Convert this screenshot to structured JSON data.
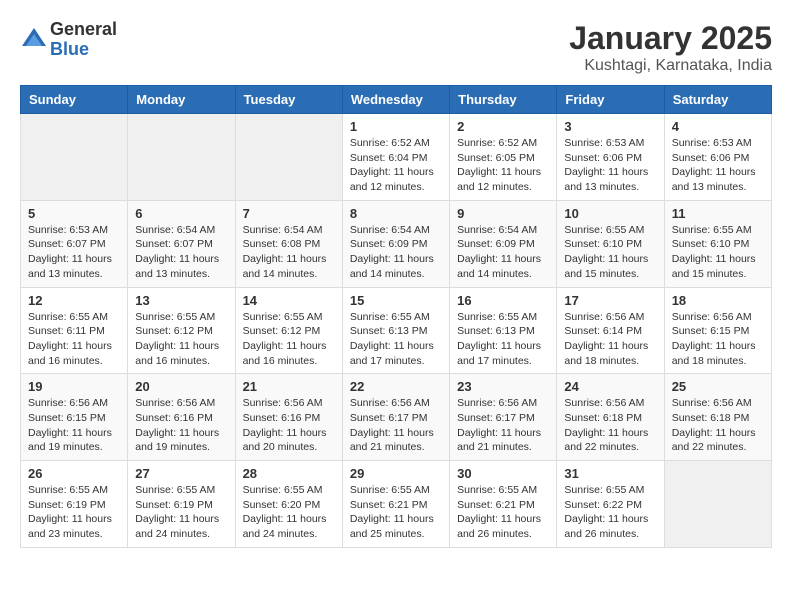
{
  "header": {
    "logo": {
      "general": "General",
      "blue": "Blue"
    },
    "title": "January 2025",
    "location": "Kushtagi, Karnataka, India"
  },
  "calendar": {
    "days_of_week": [
      "Sunday",
      "Monday",
      "Tuesday",
      "Wednesday",
      "Thursday",
      "Friday",
      "Saturday"
    ],
    "weeks": [
      [
        {
          "day": "",
          "info": ""
        },
        {
          "day": "",
          "info": ""
        },
        {
          "day": "",
          "info": ""
        },
        {
          "day": "1",
          "info": "Sunrise: 6:52 AM\nSunset: 6:04 PM\nDaylight: 11 hours\nand 12 minutes."
        },
        {
          "day": "2",
          "info": "Sunrise: 6:52 AM\nSunset: 6:05 PM\nDaylight: 11 hours\nand 12 minutes."
        },
        {
          "day": "3",
          "info": "Sunrise: 6:53 AM\nSunset: 6:06 PM\nDaylight: 11 hours\nand 13 minutes."
        },
        {
          "day": "4",
          "info": "Sunrise: 6:53 AM\nSunset: 6:06 PM\nDaylight: 11 hours\nand 13 minutes."
        }
      ],
      [
        {
          "day": "5",
          "info": "Sunrise: 6:53 AM\nSunset: 6:07 PM\nDaylight: 11 hours\nand 13 minutes."
        },
        {
          "day": "6",
          "info": "Sunrise: 6:54 AM\nSunset: 6:07 PM\nDaylight: 11 hours\nand 13 minutes."
        },
        {
          "day": "7",
          "info": "Sunrise: 6:54 AM\nSunset: 6:08 PM\nDaylight: 11 hours\nand 14 minutes."
        },
        {
          "day": "8",
          "info": "Sunrise: 6:54 AM\nSunset: 6:09 PM\nDaylight: 11 hours\nand 14 minutes."
        },
        {
          "day": "9",
          "info": "Sunrise: 6:54 AM\nSunset: 6:09 PM\nDaylight: 11 hours\nand 14 minutes."
        },
        {
          "day": "10",
          "info": "Sunrise: 6:55 AM\nSunset: 6:10 PM\nDaylight: 11 hours\nand 15 minutes."
        },
        {
          "day": "11",
          "info": "Sunrise: 6:55 AM\nSunset: 6:10 PM\nDaylight: 11 hours\nand 15 minutes."
        }
      ],
      [
        {
          "day": "12",
          "info": "Sunrise: 6:55 AM\nSunset: 6:11 PM\nDaylight: 11 hours\nand 16 minutes."
        },
        {
          "day": "13",
          "info": "Sunrise: 6:55 AM\nSunset: 6:12 PM\nDaylight: 11 hours\nand 16 minutes."
        },
        {
          "day": "14",
          "info": "Sunrise: 6:55 AM\nSunset: 6:12 PM\nDaylight: 11 hours\nand 16 minutes."
        },
        {
          "day": "15",
          "info": "Sunrise: 6:55 AM\nSunset: 6:13 PM\nDaylight: 11 hours\nand 17 minutes."
        },
        {
          "day": "16",
          "info": "Sunrise: 6:55 AM\nSunset: 6:13 PM\nDaylight: 11 hours\nand 17 minutes."
        },
        {
          "day": "17",
          "info": "Sunrise: 6:56 AM\nSunset: 6:14 PM\nDaylight: 11 hours\nand 18 minutes."
        },
        {
          "day": "18",
          "info": "Sunrise: 6:56 AM\nSunset: 6:15 PM\nDaylight: 11 hours\nand 18 minutes."
        }
      ],
      [
        {
          "day": "19",
          "info": "Sunrise: 6:56 AM\nSunset: 6:15 PM\nDaylight: 11 hours\nand 19 minutes."
        },
        {
          "day": "20",
          "info": "Sunrise: 6:56 AM\nSunset: 6:16 PM\nDaylight: 11 hours\nand 19 minutes."
        },
        {
          "day": "21",
          "info": "Sunrise: 6:56 AM\nSunset: 6:16 PM\nDaylight: 11 hours\nand 20 minutes."
        },
        {
          "day": "22",
          "info": "Sunrise: 6:56 AM\nSunset: 6:17 PM\nDaylight: 11 hours\nand 21 minutes."
        },
        {
          "day": "23",
          "info": "Sunrise: 6:56 AM\nSunset: 6:17 PM\nDaylight: 11 hours\nand 21 minutes."
        },
        {
          "day": "24",
          "info": "Sunrise: 6:56 AM\nSunset: 6:18 PM\nDaylight: 11 hours\nand 22 minutes."
        },
        {
          "day": "25",
          "info": "Sunrise: 6:56 AM\nSunset: 6:18 PM\nDaylight: 11 hours\nand 22 minutes."
        }
      ],
      [
        {
          "day": "26",
          "info": "Sunrise: 6:55 AM\nSunset: 6:19 PM\nDaylight: 11 hours\nand 23 minutes."
        },
        {
          "day": "27",
          "info": "Sunrise: 6:55 AM\nSunset: 6:19 PM\nDaylight: 11 hours\nand 24 minutes."
        },
        {
          "day": "28",
          "info": "Sunrise: 6:55 AM\nSunset: 6:20 PM\nDaylight: 11 hours\nand 24 minutes."
        },
        {
          "day": "29",
          "info": "Sunrise: 6:55 AM\nSunset: 6:21 PM\nDaylight: 11 hours\nand 25 minutes."
        },
        {
          "day": "30",
          "info": "Sunrise: 6:55 AM\nSunset: 6:21 PM\nDaylight: 11 hours\nand 26 minutes."
        },
        {
          "day": "31",
          "info": "Sunrise: 6:55 AM\nSunset: 6:22 PM\nDaylight: 11 hours\nand 26 minutes."
        },
        {
          "day": "",
          "info": ""
        }
      ]
    ]
  }
}
